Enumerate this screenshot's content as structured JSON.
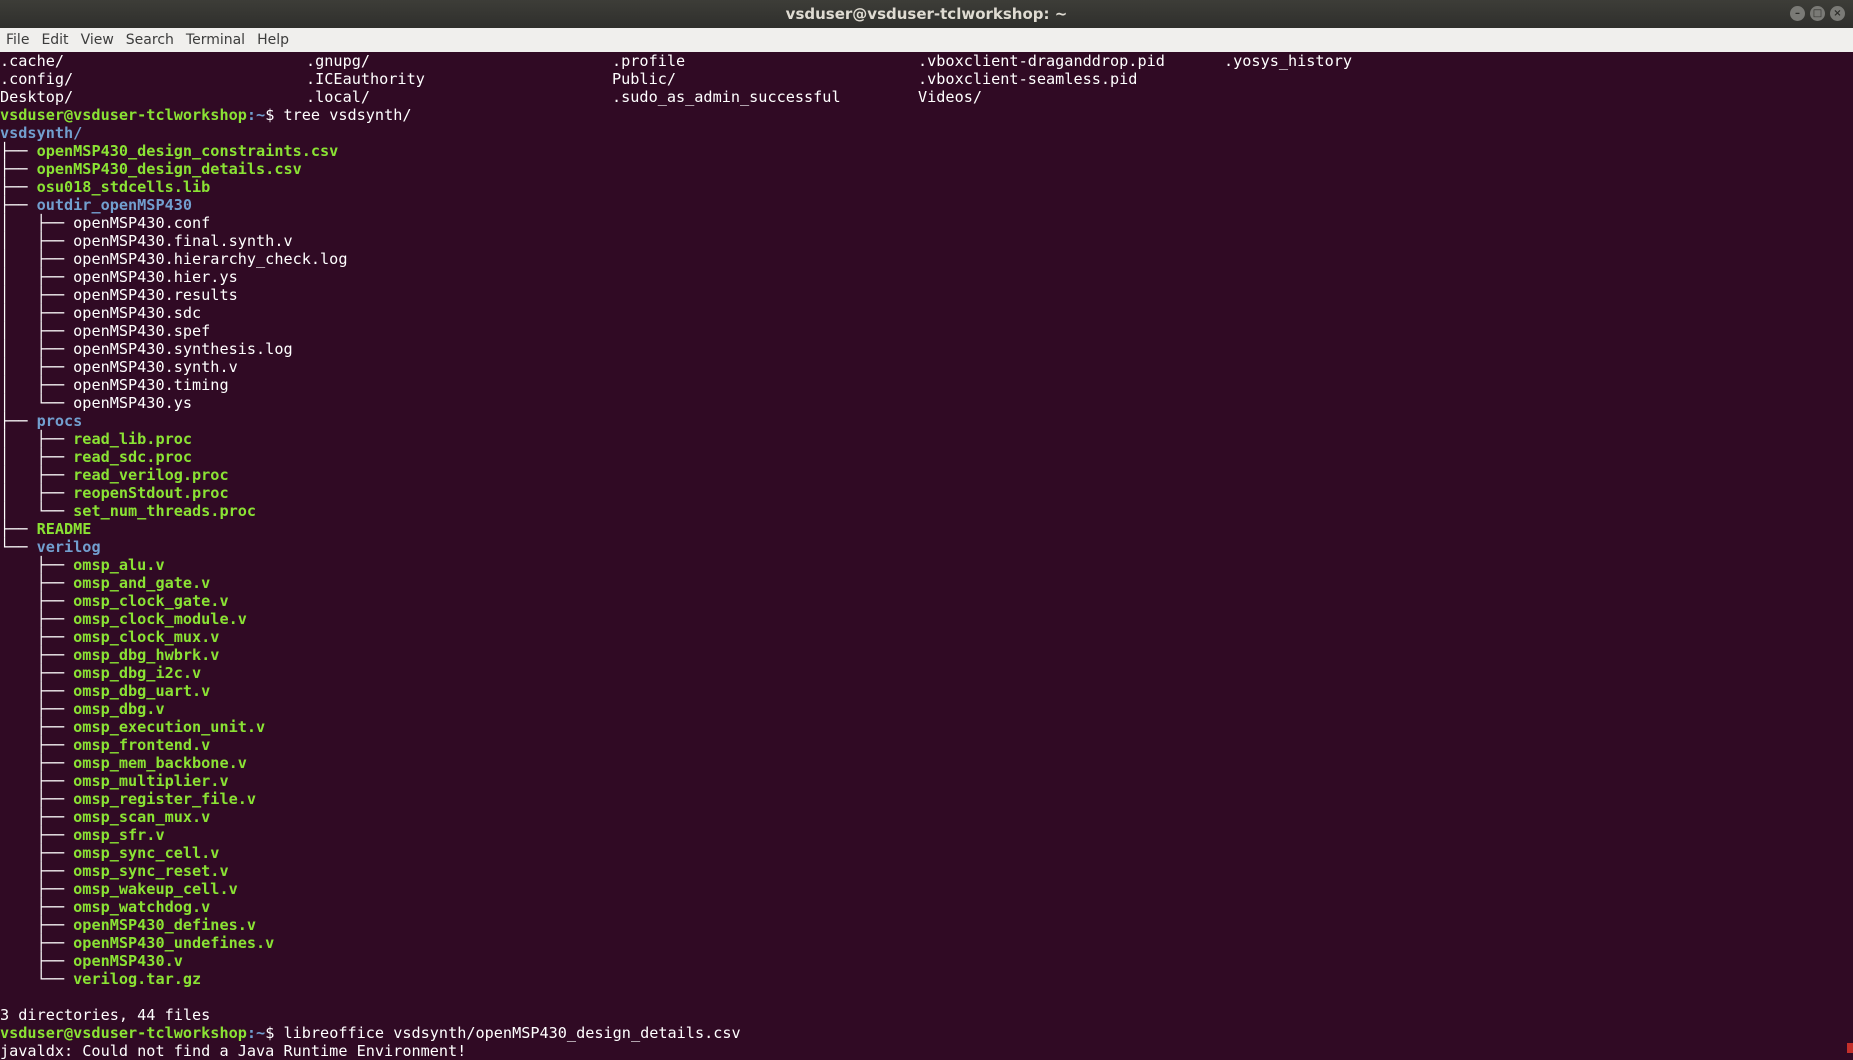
{
  "window": {
    "title": "vsduser@vsduser-tclworkshop: ~"
  },
  "menu": [
    "File",
    "Edit",
    "View",
    "Search",
    "Terminal",
    "Help"
  ],
  "ls_rows": [
    [
      ".cache/",
      ".gnupg/",
      ".profile",
      ".vboxclient-draganddrop.pid",
      ".yosys_history"
    ],
    [
      ".config/",
      ".ICEauthority",
      "Public/",
      ".vboxclient-seamless.pid",
      ""
    ],
    [
      "Desktop/",
      ".local/",
      ".sudo_as_admin_successful",
      "Videos/",
      ""
    ]
  ],
  "prompt": {
    "user": "vsduser@vsduser-tclworkshop",
    "path": ":~",
    "symbol": "$ "
  },
  "cmd1": "tree vsdsynth/",
  "tree": [
    {
      "prefix": "",
      "name": "vsdsynth/",
      "type": "dir"
    },
    {
      "prefix": "├── ",
      "name": "openMSP430_design_constraints.csv",
      "type": "exec"
    },
    {
      "prefix": "├── ",
      "name": "openMSP430_design_details.csv",
      "type": "exec"
    },
    {
      "prefix": "├── ",
      "name": "osu018_stdcells.lib",
      "type": "exec"
    },
    {
      "prefix": "├── ",
      "name": "outdir_openMSP430",
      "type": "dir"
    },
    {
      "prefix": "│   ├── ",
      "name": "openMSP430.conf",
      "type": "file"
    },
    {
      "prefix": "│   ├── ",
      "name": "openMSP430.final.synth.v",
      "type": "file"
    },
    {
      "prefix": "│   ├── ",
      "name": "openMSP430.hierarchy_check.log",
      "type": "file"
    },
    {
      "prefix": "│   ├── ",
      "name": "openMSP430.hier.ys",
      "type": "file"
    },
    {
      "prefix": "│   ├── ",
      "name": "openMSP430.results",
      "type": "file"
    },
    {
      "prefix": "│   ├── ",
      "name": "openMSP430.sdc",
      "type": "file"
    },
    {
      "prefix": "│   ├── ",
      "name": "openMSP430.spef",
      "type": "file"
    },
    {
      "prefix": "│   ├── ",
      "name": "openMSP430.synthesis.log",
      "type": "file"
    },
    {
      "prefix": "│   ├── ",
      "name": "openMSP430.synth.v",
      "type": "file"
    },
    {
      "prefix": "│   ├── ",
      "name": "openMSP430.timing",
      "type": "file"
    },
    {
      "prefix": "│   └── ",
      "name": "openMSP430.ys",
      "type": "file"
    },
    {
      "prefix": "├── ",
      "name": "procs",
      "type": "dir"
    },
    {
      "prefix": "│   ├── ",
      "name": "read_lib.proc",
      "type": "exec"
    },
    {
      "prefix": "│   ├── ",
      "name": "read_sdc.proc",
      "type": "exec"
    },
    {
      "prefix": "│   ├── ",
      "name": "read_verilog.proc",
      "type": "exec"
    },
    {
      "prefix": "│   ├── ",
      "name": "reopenStdout.proc",
      "type": "exec"
    },
    {
      "prefix": "│   └── ",
      "name": "set_num_threads.proc",
      "type": "exec"
    },
    {
      "prefix": "├── ",
      "name": "README",
      "type": "exec"
    },
    {
      "prefix": "└── ",
      "name": "verilog",
      "type": "dir"
    },
    {
      "prefix": "    ├── ",
      "name": "omsp_alu.v",
      "type": "exec"
    },
    {
      "prefix": "    ├── ",
      "name": "omsp_and_gate.v",
      "type": "exec"
    },
    {
      "prefix": "    ├── ",
      "name": "omsp_clock_gate.v",
      "type": "exec"
    },
    {
      "prefix": "    ├── ",
      "name": "omsp_clock_module.v",
      "type": "exec"
    },
    {
      "prefix": "    ├── ",
      "name": "omsp_clock_mux.v",
      "type": "exec"
    },
    {
      "prefix": "    ├── ",
      "name": "omsp_dbg_hwbrk.v",
      "type": "exec"
    },
    {
      "prefix": "    ├── ",
      "name": "omsp_dbg_i2c.v",
      "type": "exec"
    },
    {
      "prefix": "    ├── ",
      "name": "omsp_dbg_uart.v",
      "type": "exec"
    },
    {
      "prefix": "    ├── ",
      "name": "omsp_dbg.v",
      "type": "exec"
    },
    {
      "prefix": "    ├── ",
      "name": "omsp_execution_unit.v",
      "type": "exec"
    },
    {
      "prefix": "    ├── ",
      "name": "omsp_frontend.v",
      "type": "exec"
    },
    {
      "prefix": "    ├── ",
      "name": "omsp_mem_backbone.v",
      "type": "exec"
    },
    {
      "prefix": "    ├── ",
      "name": "omsp_multiplier.v",
      "type": "exec"
    },
    {
      "prefix": "    ├── ",
      "name": "omsp_register_file.v",
      "type": "exec"
    },
    {
      "prefix": "    ├── ",
      "name": "omsp_scan_mux.v",
      "type": "exec"
    },
    {
      "prefix": "    ├── ",
      "name": "omsp_sfr.v",
      "type": "exec"
    },
    {
      "prefix": "    ├── ",
      "name": "omsp_sync_cell.v",
      "type": "exec"
    },
    {
      "prefix": "    ├── ",
      "name": "omsp_sync_reset.v",
      "type": "exec"
    },
    {
      "prefix": "    ├── ",
      "name": "omsp_wakeup_cell.v",
      "type": "exec"
    },
    {
      "prefix": "    ├── ",
      "name": "omsp_watchdog.v",
      "type": "exec"
    },
    {
      "prefix": "    ├── ",
      "name": "openMSP430_defines.v",
      "type": "exec"
    },
    {
      "prefix": "    ├── ",
      "name": "openMSP430_undefines.v",
      "type": "exec"
    },
    {
      "prefix": "    ├── ",
      "name": "openMSP430.v",
      "type": "exec"
    },
    {
      "prefix": "    └── ",
      "name": "verilog.tar.gz",
      "type": "exec"
    }
  ],
  "summary": "3 directories, 44 files",
  "cmd2": "libreoffice vsdsynth/openMSP430_design_details.csv",
  "last_line": "javaldx: Could not find a Java Runtime Environment!",
  "colors": {
    "background": "#300a24",
    "green": "#8ae234",
    "blue": "#729fcf"
  }
}
